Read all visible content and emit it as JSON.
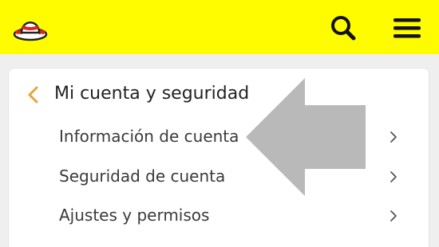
{
  "colors": {
    "header_bg": "#fffc00",
    "accent_chevron": "#e8a33d",
    "text": "#3a3a3a",
    "overlay_arrow": "#b9b9b9"
  },
  "header": {
    "logo_icon": "ghost-lifebuoy-icon",
    "search_icon": "search-icon",
    "menu_icon": "hamburger-menu-icon"
  },
  "section": {
    "back_icon": "chevron-left-icon",
    "title": "Mi cuenta y seguridad"
  },
  "items": [
    {
      "label": "Información de cuenta",
      "icon": "chevron-right-icon"
    },
    {
      "label": "Seguridad de cuenta",
      "icon": "chevron-right-icon"
    },
    {
      "label": "Ajustes y permisos",
      "icon": "chevron-right-icon"
    }
  ],
  "overlay": {
    "icon": "left-pointing-arrow-icon"
  }
}
